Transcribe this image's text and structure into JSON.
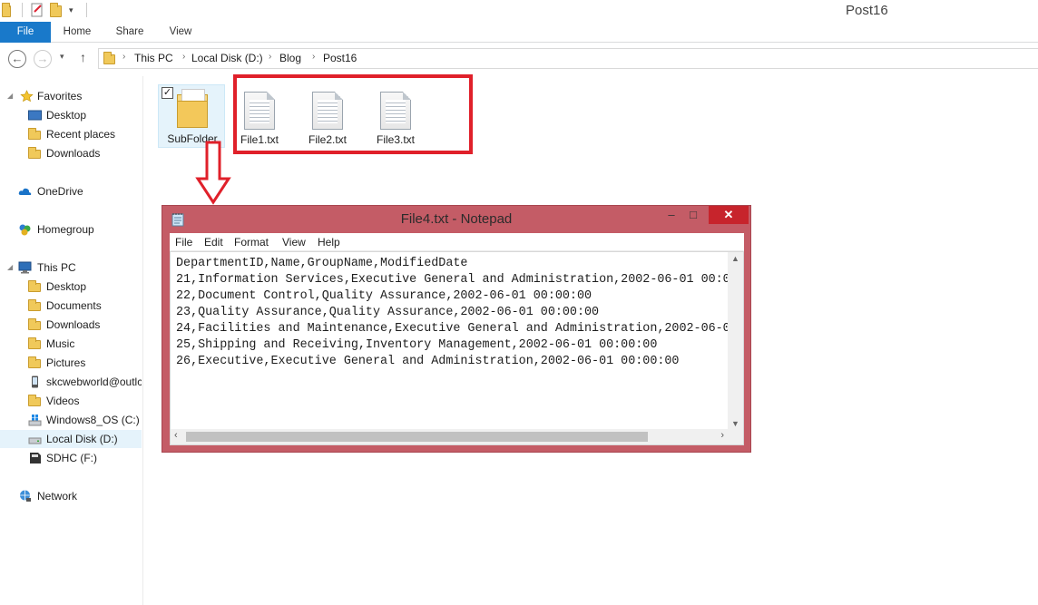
{
  "window": {
    "title": "Post16"
  },
  "ribbon": {
    "tabs": [
      "File",
      "Home",
      "Share",
      "View"
    ]
  },
  "address": {
    "crumbs": [
      "This PC",
      "Local Disk (D:)",
      "Blog",
      "Post16"
    ]
  },
  "sidebar": {
    "favorites": {
      "label": "Favorites",
      "items": [
        "Desktop",
        "Recent places",
        "Downloads"
      ]
    },
    "onedrive": "OneDrive",
    "homegroup": "Homegroup",
    "thispc": {
      "label": "This PC",
      "items": [
        "Desktop",
        "Documents",
        "Downloads",
        "Music",
        "Pictures",
        "skcwebworld@outlc",
        "Videos",
        "Windows8_OS (C:)",
        "Local Disk (D:)",
        "SDHC (F:)"
      ]
    },
    "network": "Network"
  },
  "files": [
    {
      "name": "SubFolder",
      "type": "folder",
      "checked": true
    },
    {
      "name": "File1.txt",
      "type": "text"
    },
    {
      "name": "File2.txt",
      "type": "text"
    },
    {
      "name": "File3.txt",
      "type": "text"
    }
  ],
  "colors": {
    "annotation": "#e0202a",
    "file_tab": "#1979ca",
    "notepad_frame": "#c45c66"
  },
  "notepad": {
    "title": "File4.txt - Notepad",
    "menu": [
      "File",
      "Edit",
      "Format",
      "View",
      "Help"
    ],
    "lines": [
      "DepartmentID,Name,GroupName,ModifiedDate",
      "21,Information Services,Executive General and Administration,2002-06-01 00:0",
      "22,Document Control,Quality Assurance,2002-06-01 00:00:00",
      "23,Quality Assurance,Quality Assurance,2002-06-01 00:00:00",
      "24,Facilities and Maintenance,Executive General and Administration,2002-06-0",
      "25,Shipping and Receiving,Inventory Management,2002-06-01 00:00:00",
      "26,Executive,Executive General and Administration,2002-06-01 00:00:00"
    ]
  }
}
